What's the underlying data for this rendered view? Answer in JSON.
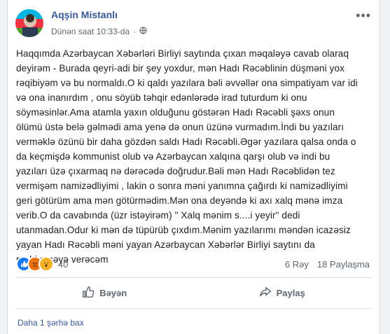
{
  "post": {
    "author": "Aqşin Mistanlı",
    "timestamp": "Dünən saat 10:33-da",
    "privacy_icon": "globe-icon",
    "more_icon": "ellipsis-icon",
    "text": "Haqqımda Azərbaycan Xəbərləri Birliyi saytında çıxan məqaləyə cavab olaraq deyirəm - Burada qeyri-adi bir şey yoxdur, mən Hadı Rəcəblinin düşməni yox rəqibiyəm və bu normaldı.O ki qaldı yazılara bəli əvvəllər ona simpatiyam var idi və ona inanırdım , onu söyüb təhqir edənlərədə irad tuturdum ki onu söyməsinlər.Ama atamla yaxın olduğunu göstərən Hadı Rəcəbli şəxs onun ölümü üstə belə gəlmədi ama yenə də onun üzünə vurmadım.İndi bu yazıları verməklə özünü bir daha gözdən saldı Hadı Rəcəbli.Əgər yazılara qalsa onda o da keçmişdə kommunist olub və Azərbaycan xalqına qarşı olub və indi bu yazıları üzə çıxarmaq nə dərəcədə doğrudur.Bəli mən Hadı Rəcəblidən tez vermişəm namizədliyimi , lakin o sonra məni yanımna çağırdı ki namizədliyimi geri götürüm ama mən götürmədim.Mən ona deyəndə ki axı xalq mənə imza verib.O da cavabında (üzr istəyirəm) \" Xalq mənim s....i yeyir\" dedi utanmadan.Odur ki mən də tüpürüb çıxdım.Mənim yazılarımı məndən icazəsiz yayan Hadı Rəcəbli məni yayan Azərbaycan Xəbərlər Birliyi saytını da məhkəməyə verəcəm"
  },
  "reactions": {
    "icons": [
      "like-reaction-icon",
      "angry-reaction-icon",
      "wow-reaction-icon"
    ],
    "count": "40",
    "comments": "6 Rəy",
    "shares": "18 Paylaşma"
  },
  "actions": {
    "like_label": "Bəyən",
    "share_label": "Paylaş"
  },
  "footer": {
    "more_comments": "Daha 1 şərhə bax"
  },
  "colors": {
    "author": "#385898",
    "text": "#1c1e21",
    "muted": "#606770",
    "background": "#f0f2f5",
    "like_blue": "#1877f2",
    "angry": "#e9710f",
    "wow": "#f7b125"
  }
}
